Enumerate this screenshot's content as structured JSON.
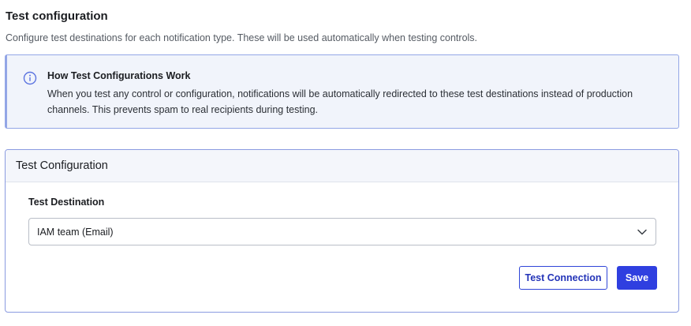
{
  "header": {
    "title": "Test configuration",
    "subtitle": "Configure test destinations for each notification type. These will be used automatically when testing controls."
  },
  "info": {
    "icon": "info-circle-icon",
    "heading": "How Test Configurations Work",
    "body": "When you test any control or configuration, notifications will be automatically redirected to these test destinations instead of production channels. This prevents spam to real recipients during testing."
  },
  "card": {
    "title": "Test Configuration",
    "destination": {
      "label": "Test Destination",
      "selected": "IAM team (Email)"
    },
    "buttons": {
      "test_connection": "Test Connection",
      "save": "Save"
    }
  },
  "colors": {
    "accent": "#2f3fe0",
    "info_border": "#93a6e6",
    "info_bg": "#f1f4fb"
  }
}
